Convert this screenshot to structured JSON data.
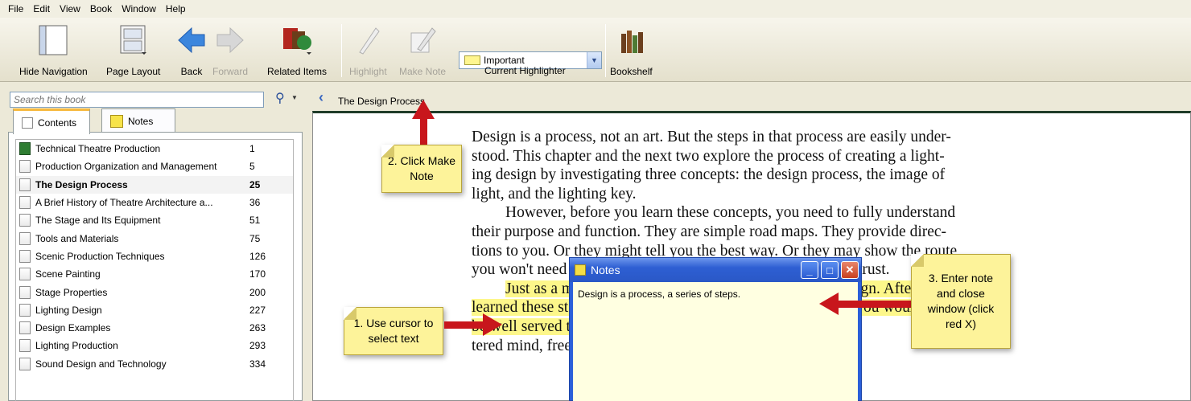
{
  "menu": [
    "File",
    "Edit",
    "View",
    "Book",
    "Window",
    "Help"
  ],
  "toolbar": {
    "hide_navigation": "Hide Navigation",
    "page_layout": "Page Layout",
    "back": "Back",
    "forward": "Forward",
    "related_items": "Related Items",
    "highlight": "Highlight",
    "make_note": "Make Note",
    "highlighter_value": "Important",
    "current_highlighter": "Current Highlighter",
    "bookshelf": "Bookshelf"
  },
  "search": {
    "placeholder": "Search this book"
  },
  "breadcrumb": "The Design Process",
  "tabs": {
    "contents": "Contents",
    "notes": "Notes"
  },
  "toc": [
    {
      "title": "Technical Theatre Production",
      "page": "1"
    },
    {
      "title": "Production Organization and Management",
      "page": "5"
    },
    {
      "title": "The Design Process",
      "page": "25"
    },
    {
      "title": "A Brief History of Theatre Architecture a...",
      "page": "36"
    },
    {
      "title": "The Stage and Its Equipment",
      "page": "51"
    },
    {
      "title": "Tools and Materials",
      "page": "75"
    },
    {
      "title": "Scenic Production Techniques",
      "page": "126"
    },
    {
      "title": "Scene Painting",
      "page": "170"
    },
    {
      "title": "Stage Properties",
      "page": "200"
    },
    {
      "title": "Lighting Design",
      "page": "227"
    },
    {
      "title": "Design Examples",
      "page": "263"
    },
    {
      "title": "Lighting Production",
      "page": "293"
    },
    {
      "title": "Sound Design and Technology",
      "page": "334"
    }
  ],
  "page": {
    "p1_l1": "Design is a process, not an art. But the steps in that process are easily under-",
    "p1_l2": "stood. This chapter and the next two explore the process of creating a light-",
    "p1_l3": "ing design by investigating three concepts: the design process, the image of",
    "p1_l4": "light, and the lighting key.",
    "p2_l1": "However, before you learn these concepts, you need to fully understand",
    "p2_l2": "their purpose and function. They are simple road maps. They provide direc-",
    "p2_l3": "tions to you. Or they might tell you the best way. Or they may show the route",
    "p2_l4": "you won't need to take, because a faster one is available. Just trust.",
    "p3_l1": "Just as a map is not the journey, the process isn't the design. After you've",
    "p3_l2": "learned these steps, you'll find that following them slavishly, you would",
    "p3_l3": "be well served to keep them in mind. Why? Because an unfet-",
    "p3_l4": "tered mind, free from slavishly following each step in"
  },
  "notes_window": {
    "title": "Notes",
    "text": "Design is a process, a series of steps."
  },
  "callouts": {
    "c1": "1.  Use cursor to select text",
    "c2": "2. Click Make Note",
    "c3": "3.  Enter note and close window (click red X)"
  },
  "colors": {
    "highlight": "#fdf78a",
    "callout": "#fdf39a",
    "arrow": "#c8161c",
    "title_bar": "#2e5fd3"
  }
}
